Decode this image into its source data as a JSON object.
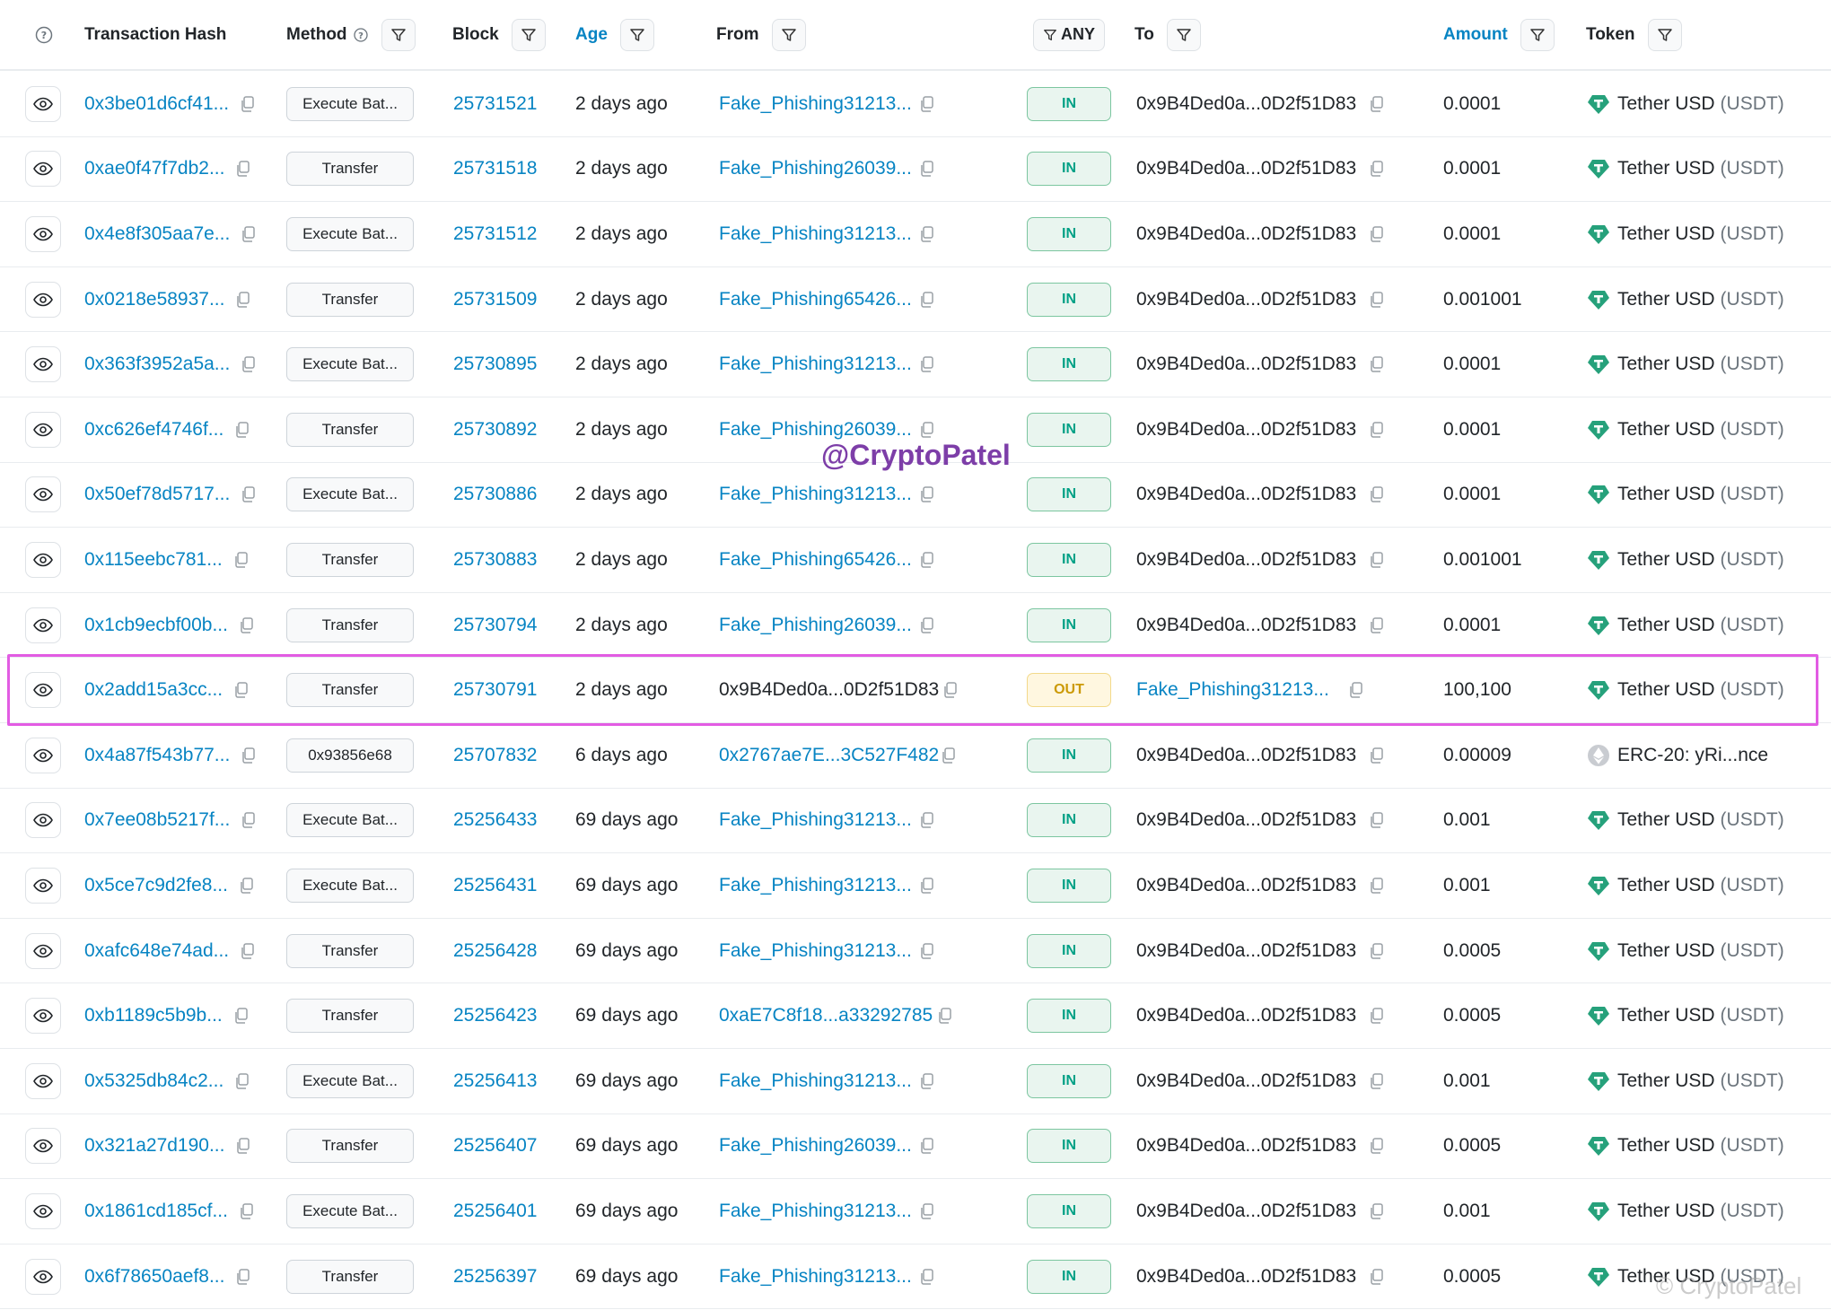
{
  "header": {
    "info_icon": "info-icon",
    "tx_hash": "Transaction Hash",
    "method": "Method",
    "block": "Block",
    "age": "Age",
    "from": "From",
    "any": "ANY",
    "to": "To",
    "amount": "Amount",
    "token": "Token"
  },
  "watermark": "@CryptoPatel",
  "corner_watermark": "© CryptoPatel",
  "colors": {
    "link": "#0784c3",
    "in_badge": "#00a186",
    "out_badge": "#cc9a06",
    "highlight": "#e25ce3",
    "tether": "#26a17b"
  },
  "rows": [
    {
      "hash": "0x3be01d6cf41...",
      "method": "Execute Bat...",
      "block": "25731521",
      "age": "2 days ago",
      "from": "Fake_Phishing31213...",
      "from_link": true,
      "dir": "IN",
      "to": "0x9B4Ded0a...0D2f51D83",
      "to_link": false,
      "amount": "0.0001",
      "token_name": "Tether USD",
      "token_symbol": "(USDT)",
      "token_icon": "tether-icon"
    },
    {
      "hash": "0xae0f47f7db2...",
      "method": "Transfer",
      "block": "25731518",
      "age": "2 days ago",
      "from": "Fake_Phishing26039...",
      "from_link": true,
      "dir": "IN",
      "to": "0x9B4Ded0a...0D2f51D83",
      "to_link": false,
      "amount": "0.0001",
      "token_name": "Tether USD",
      "token_symbol": "(USDT)",
      "token_icon": "tether-icon"
    },
    {
      "hash": "0x4e8f305aa7e...",
      "method": "Execute Bat...",
      "block": "25731512",
      "age": "2 days ago",
      "from": "Fake_Phishing31213...",
      "from_link": true,
      "dir": "IN",
      "to": "0x9B4Ded0a...0D2f51D83",
      "to_link": false,
      "amount": "0.0001",
      "token_name": "Tether USD",
      "token_symbol": "(USDT)",
      "token_icon": "tether-icon"
    },
    {
      "hash": "0x0218e58937...",
      "method": "Transfer",
      "block": "25731509",
      "age": "2 days ago",
      "from": "Fake_Phishing65426...",
      "from_link": true,
      "dir": "IN",
      "to": "0x9B4Ded0a...0D2f51D83",
      "to_link": false,
      "amount": "0.001001",
      "token_name": "Tether USD",
      "token_symbol": "(USDT)",
      "token_icon": "tether-icon"
    },
    {
      "hash": "0x363f3952a5a...",
      "method": "Execute Bat...",
      "block": "25730895",
      "age": "2 days ago",
      "from": "Fake_Phishing31213...",
      "from_link": true,
      "dir": "IN",
      "to": "0x9B4Ded0a...0D2f51D83",
      "to_link": false,
      "amount": "0.0001",
      "token_name": "Tether USD",
      "token_symbol": "(USDT)",
      "token_icon": "tether-icon"
    },
    {
      "hash": "0xc626ef4746f...",
      "method": "Transfer",
      "block": "25730892",
      "age": "2 days ago",
      "from": "Fake_Phishing26039...",
      "from_link": true,
      "dir": "IN",
      "to": "0x9B4Ded0a...0D2f51D83",
      "to_link": false,
      "amount": "0.0001",
      "token_name": "Tether USD",
      "token_symbol": "(USDT)",
      "token_icon": "tether-icon"
    },
    {
      "hash": "0x50ef78d5717...",
      "method": "Execute Bat...",
      "block": "25730886",
      "age": "2 days ago",
      "from": "Fake_Phishing31213...",
      "from_link": true,
      "dir": "IN",
      "to": "0x9B4Ded0a...0D2f51D83",
      "to_link": false,
      "amount": "0.0001",
      "token_name": "Tether USD",
      "token_symbol": "(USDT)",
      "token_icon": "tether-icon"
    },
    {
      "hash": "0x115eebc781...",
      "method": "Transfer",
      "block": "25730883",
      "age": "2 days ago",
      "from": "Fake_Phishing65426...",
      "from_link": true,
      "dir": "IN",
      "to": "0x9B4Ded0a...0D2f51D83",
      "to_link": false,
      "amount": "0.001001",
      "token_name": "Tether USD",
      "token_symbol": "(USDT)",
      "token_icon": "tether-icon"
    },
    {
      "hash": "0x1cb9ecbf00b...",
      "method": "Transfer",
      "block": "25730794",
      "age": "2 days ago",
      "from": "Fake_Phishing26039...",
      "from_link": true,
      "dir": "IN",
      "to": "0x9B4Ded0a...0D2f51D83",
      "to_link": false,
      "amount": "0.0001",
      "token_name": "Tether USD",
      "token_symbol": "(USDT)",
      "token_icon": "tether-icon"
    },
    {
      "hash": "0x2add15a3cc...",
      "method": "Transfer",
      "block": "25730791",
      "age": "2 days ago",
      "from": "0x9B4Ded0a...0D2f51D83",
      "from_link": false,
      "dir": "OUT",
      "to": "Fake_Phishing31213...",
      "to_link": true,
      "amount": "100,100",
      "token_name": "Tether USD",
      "token_symbol": "(USDT)",
      "token_icon": "tether-icon",
      "highlighted": true
    },
    {
      "hash": "0x4a87f543b77...",
      "method": "0x93856e68",
      "block": "25707832",
      "age": "6 days ago",
      "from": "0x2767ae7E...3C527F482",
      "from_link": true,
      "dir": "IN",
      "to": "0x9B4Ded0a...0D2f51D83",
      "to_link": false,
      "amount": "0.00009",
      "token_name": "ERC-20: yRi...nce",
      "token_symbol": "",
      "token_icon": "erc20-icon"
    },
    {
      "hash": "0x7ee08b5217f...",
      "method": "Execute Bat...",
      "block": "25256433",
      "age": "69 days ago",
      "from": "Fake_Phishing31213...",
      "from_link": true,
      "dir": "IN",
      "to": "0x9B4Ded0a...0D2f51D83",
      "to_link": false,
      "amount": "0.001",
      "token_name": "Tether USD",
      "token_symbol": "(USDT)",
      "token_icon": "tether-icon"
    },
    {
      "hash": "0x5ce7c9d2fe8...",
      "method": "Execute Bat...",
      "block": "25256431",
      "age": "69 days ago",
      "from": "Fake_Phishing31213...",
      "from_link": true,
      "dir": "IN",
      "to": "0x9B4Ded0a...0D2f51D83",
      "to_link": false,
      "amount": "0.001",
      "token_name": "Tether USD",
      "token_symbol": "(USDT)",
      "token_icon": "tether-icon"
    },
    {
      "hash": "0xafc648e74ad...",
      "method": "Transfer",
      "block": "25256428",
      "age": "69 days ago",
      "from": "Fake_Phishing31213...",
      "from_link": true,
      "dir": "IN",
      "to": "0x9B4Ded0a...0D2f51D83",
      "to_link": false,
      "amount": "0.0005",
      "token_name": "Tether USD",
      "token_symbol": "(USDT)",
      "token_icon": "tether-icon"
    },
    {
      "hash": "0xb1189c5b9b...",
      "method": "Transfer",
      "block": "25256423",
      "age": "69 days ago",
      "from": "0xaE7C8f18...a33292785",
      "from_link": true,
      "dir": "IN",
      "to": "0x9B4Ded0a...0D2f51D83",
      "to_link": false,
      "amount": "0.0005",
      "token_name": "Tether USD",
      "token_symbol": "(USDT)",
      "token_icon": "tether-icon"
    },
    {
      "hash": "0x5325db84c2...",
      "method": "Execute Bat...",
      "block": "25256413",
      "age": "69 days ago",
      "from": "Fake_Phishing31213...",
      "from_link": true,
      "dir": "IN",
      "to": "0x9B4Ded0a...0D2f51D83",
      "to_link": false,
      "amount": "0.001",
      "token_name": "Tether USD",
      "token_symbol": "(USDT)",
      "token_icon": "tether-icon"
    },
    {
      "hash": "0x321a27d190...",
      "method": "Transfer",
      "block": "25256407",
      "age": "69 days ago",
      "from": "Fake_Phishing26039...",
      "from_link": true,
      "dir": "IN",
      "to": "0x9B4Ded0a...0D2f51D83",
      "to_link": false,
      "amount": "0.0005",
      "token_name": "Tether USD",
      "token_symbol": "(USDT)",
      "token_icon": "tether-icon"
    },
    {
      "hash": "0x1861cd185cf...",
      "method": "Execute Bat...",
      "block": "25256401",
      "age": "69 days ago",
      "from": "Fake_Phishing31213...",
      "from_link": true,
      "dir": "IN",
      "to": "0x9B4Ded0a...0D2f51D83",
      "to_link": false,
      "amount": "0.001",
      "token_name": "Tether USD",
      "token_symbol": "(USDT)",
      "token_icon": "tether-icon"
    },
    {
      "hash": "0x6f78650aef8...",
      "method": "Transfer",
      "block": "25256397",
      "age": "69 days ago",
      "from": "Fake_Phishing31213...",
      "from_link": true,
      "dir": "IN",
      "to": "0x9B4Ded0a...0D2f51D83",
      "to_link": false,
      "amount": "0.0005",
      "token_name": "Tether USD",
      "token_symbol": "(USDT)",
      "token_icon": "tether-icon"
    }
  ]
}
